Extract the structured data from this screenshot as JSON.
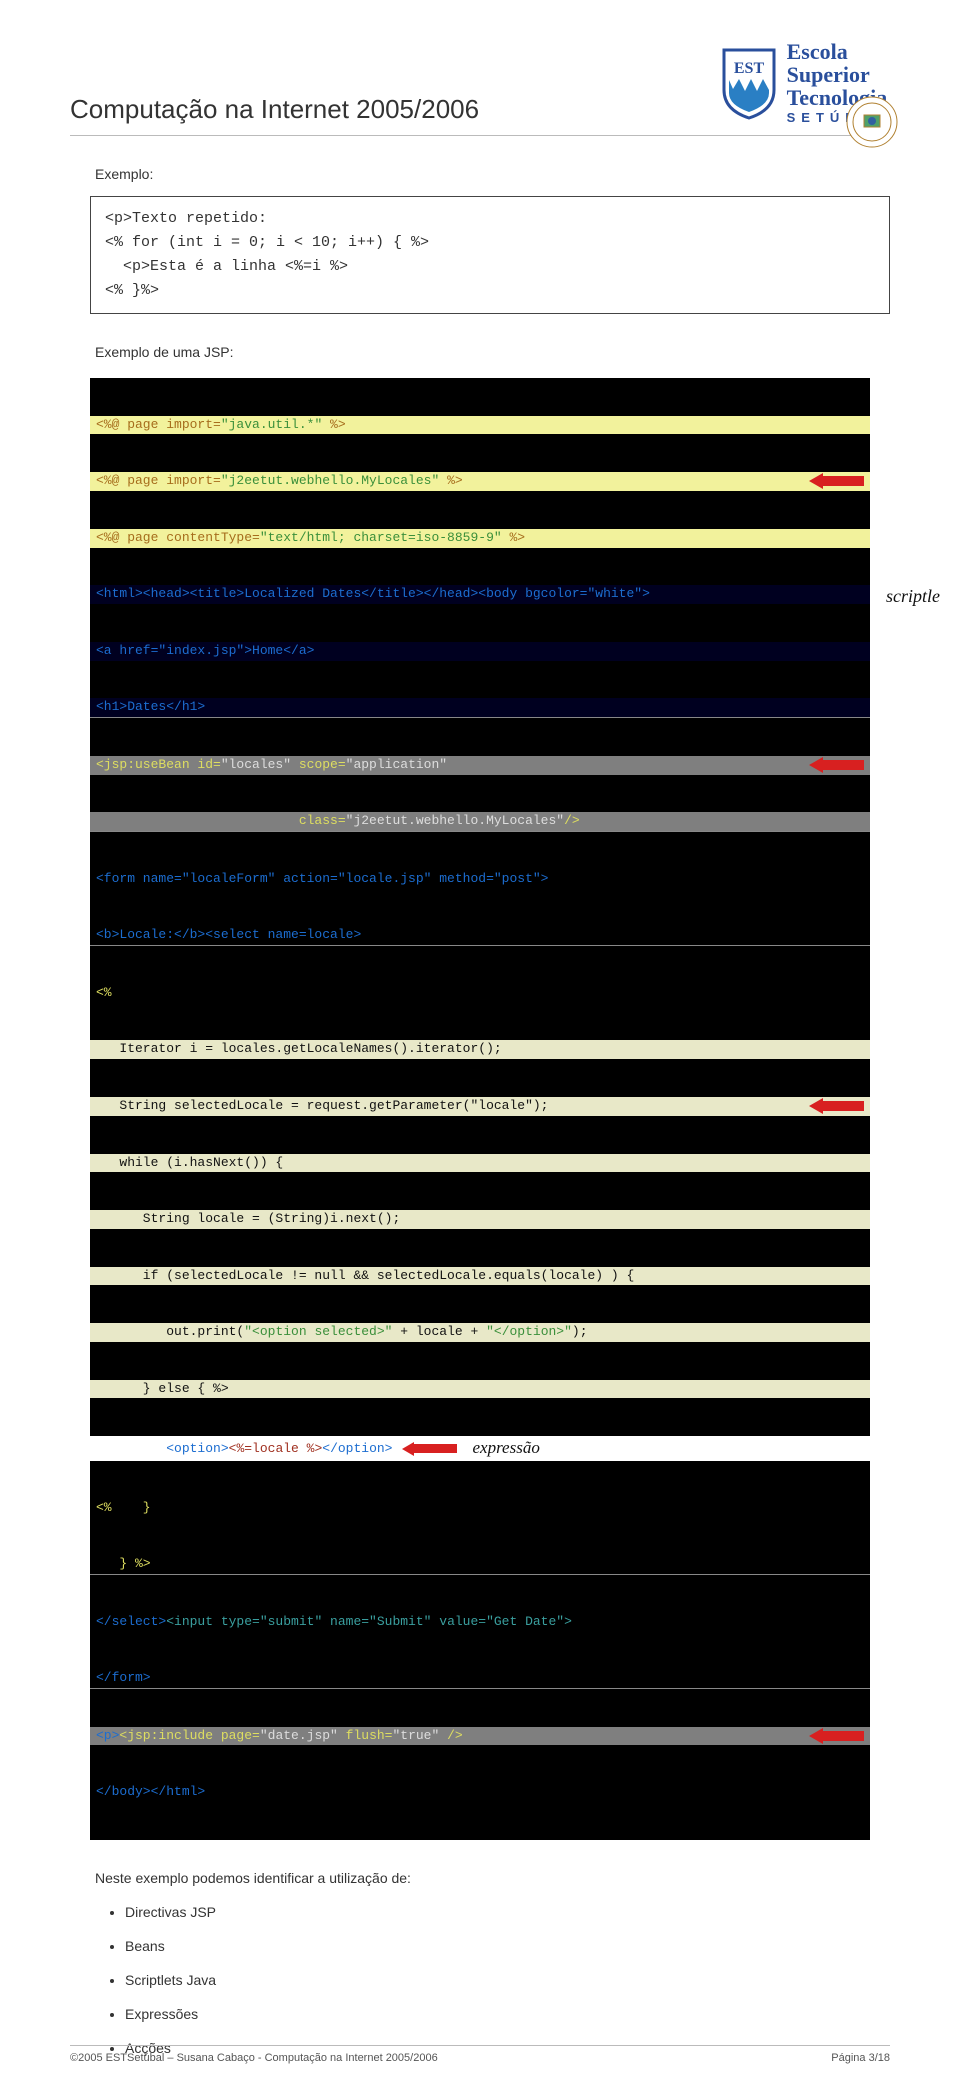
{
  "header": {
    "title": "Computação na Internet 2005/2006",
    "logo": {
      "line1": "Escola",
      "line2": "Superior",
      "line3": "Tecnologia",
      "line4": "SETÚBAL",
      "shield_text": "EST"
    }
  },
  "example": {
    "label": "Exemplo:",
    "code": {
      "l1": "<p>Texto repetido:",
      "l2": "<% for (int i = 0; i < 10; i++) { %>",
      "l3": "  <p>Esta é a linha <%=i %>",
      "l4": "<% }%>"
    }
  },
  "jsp": {
    "label": "Exemplo de uma JSP:",
    "scriptlet_label": "scriptle",
    "expression_label": "expressão",
    "lines": {
      "l01a": "<%@ page import=",
      "l01b": "\"java.util.*\"",
      "l01c": " %>",
      "l02a": "<%@ page import=",
      "l02b": "\"j2eetut.webhello.MyLocales\"",
      "l02c": " %>",
      "l03a": "<%@ page contentType=",
      "l03b": "\"text/html; charset=iso-8859-9\"",
      "l03c": " %>",
      "l04": "<html><head><title>Localized Dates</title></head><body bgcolor=\"white\">",
      "l05": "<a href=\"index.jsp\">Home</a>",
      "l06": "<h1>Dates</h1>",
      "l07a": "<jsp:useBean id=",
      "l07b": "\"locales\"",
      "l07c": " scope=",
      "l07d": "\"application\"",
      "l08a": "                          class=",
      "l08b": "\"j2eetut.webhello.MyLocales\"",
      "l08c": "/>",
      "l09": "<form name=\"localeForm\" action=\"locale.jsp\" method=\"post\">",
      "l10": "<b>Locale:</b><select name=locale>",
      "l11": "<%",
      "l12": "   Iterator i = locales.getLocaleNames().iterator();",
      "l13": "   String selectedLocale = request.getParameter(\"locale\");",
      "l14": "   while (i.hasNext()) {",
      "l15": "      String locale = (String)i.next();",
      "l16": "      if (selectedLocale != null && selectedLocale.equals(locale) ) {",
      "l17a": "         out.print(",
      "l17b": "\"<option selected>\"",
      "l17c": " + locale + ",
      "l17d": "\"</option>\"",
      "l17e": ");",
      "l18": "      } else { %>",
      "l19a": "         ",
      "l19b": "<option>",
      "l19c": "<%=locale %>",
      "l19d": "</option>",
      "l20": "<%    }",
      "l21": "   } %>",
      "l22a": "</select>",
      "l22b": "<input type=\"submit\" name=\"Submit\" value=\"Get Date\">",
      "l23": "</form>",
      "l24a": "<p>",
      "l24b": "<jsp:include page=",
      "l24c": "\"date.jsp\"",
      "l24d": " flush=",
      "l24e": "\"true\"",
      "l24f": " />",
      "l25": "</body></html>"
    }
  },
  "identify": {
    "text": "Neste exemplo podemos identificar a utilização de:",
    "items": [
      "Directivas JSP",
      "Beans",
      "Scriptlets Java",
      "Expressões",
      "Acções"
    ]
  },
  "footer": {
    "left": "©2005 ESTSetúbal – Susana Cabaço - Computação na Internet 2005/2006",
    "right": "Página 3/18"
  }
}
